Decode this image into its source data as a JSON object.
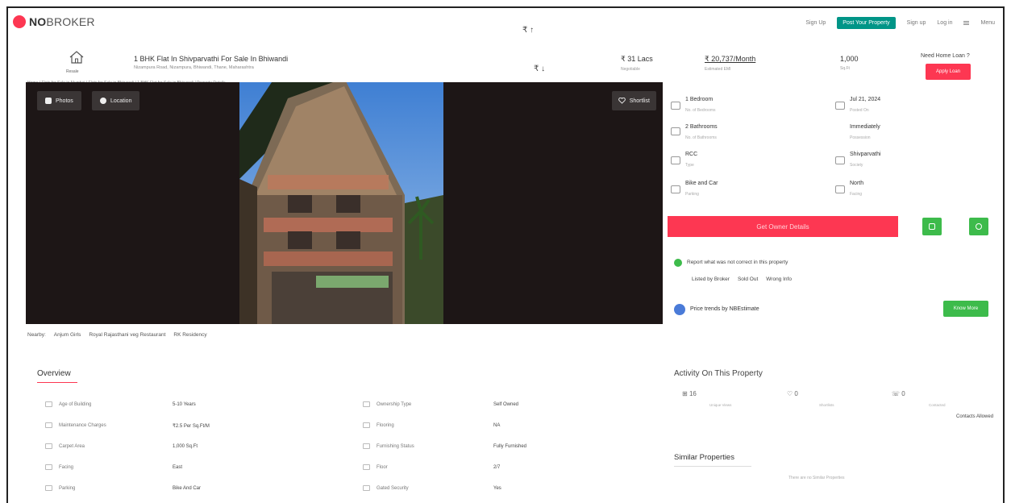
{
  "header": {
    "logo_main": "NO",
    "logo_rest": "BROKER",
    "links": [
      "Sign Up",
      "Post Your Property",
      "Sign up",
      "Log in",
      "Menu"
    ]
  },
  "property": {
    "type_label": "Resale",
    "title": "1 BHK Flat In Shivparvathi For Sale In Bhiwandi",
    "address": "Nizampura Road, Nizampura, Bhiwandi, Thane, Maharashtra",
    "breadcrumb": "Home / Flats for Sale in Mumbai / Flats for Sale in Bhiwandi / 1 BHK Flat for Sale in Bhiwandi / Property Details"
  },
  "pricing": {
    "price": "₹ 31 Lacs",
    "price_sub": "Negotiable",
    "emi": "₹ 20,737/Month",
    "emi_sub": "Estimated EMI",
    "area": "1,000",
    "area_sub": "Sq.Ft",
    "loan_question": "Need Home Loan ?",
    "apply_label": "Apply Loan"
  },
  "gallery": {
    "photos_label": "Photos",
    "location_label": "Location",
    "shortlist_label": "Shortlist"
  },
  "nearby": {
    "label": "Nearby:",
    "items": [
      "Anjum Girls",
      "Royal Rajasthani veg Restaurant",
      "RK Residency"
    ]
  },
  "overview": {
    "title": "Overview",
    "rows": [
      {
        "label": "Age of Building",
        "value": "5-10 Years"
      },
      {
        "label": "Ownership Type",
        "value": "Self Owned"
      },
      {
        "label": "Maintenance Charges",
        "value": "₹2.5 Per Sq.Ft/M"
      },
      {
        "label": "Flooring",
        "value": "NA"
      },
      {
        "label": "Carpet Area",
        "value": "1,000 Sq.Ft"
      },
      {
        "label": "Furnishing Status",
        "value": "Fully Furnished"
      },
      {
        "label": "Facing",
        "value": "East"
      },
      {
        "label": "Floor",
        "value": "2/7"
      },
      {
        "label": "Parking",
        "value": "Bike And Car"
      },
      {
        "label": "Gated Security",
        "value": "Yes"
      }
    ]
  },
  "details": [
    {
      "value": "1 Bedroom",
      "sub": "No. of Bedrooms"
    },
    {
      "value": "Jul 21, 2024",
      "sub": "Posted On"
    },
    {
      "value": "2 Bathrooms",
      "sub": "No. of Bathrooms"
    },
    {
      "value": "Immediately",
      "sub": "Possession"
    },
    {
      "value": "RCC",
      "sub": "Type"
    },
    {
      "value": "Shivparvathi",
      "sub": "Society"
    },
    {
      "value": "Bike and Car",
      "sub": "Parking"
    },
    {
      "value": "North",
      "sub": "Facing"
    }
  ],
  "owner": {
    "cta_label": "Get Owner Details",
    "report_text": "Report what was not correct in this property",
    "report_opts": [
      "Listed by Broker",
      "Sold Out",
      "Wrong Info"
    ]
  },
  "trends": {
    "label": "Price trends by NBEstimate",
    "cta": "Know More"
  },
  "activity": {
    "title": "Activity On This Property",
    "stats": [
      {
        "value": "16",
        "sub": "Unique Views"
      },
      {
        "value": "0",
        "sub": "Shortlists"
      },
      {
        "value": "0",
        "sub": "Contacted"
      }
    ],
    "link": "Contacts Allowed"
  },
  "similar": {
    "title": "Similar Properties",
    "empty": "There are no Similar Properties"
  },
  "colors": {
    "brand": "#fd3752",
    "green": "#3dbb4b",
    "teal": "#009587"
  }
}
